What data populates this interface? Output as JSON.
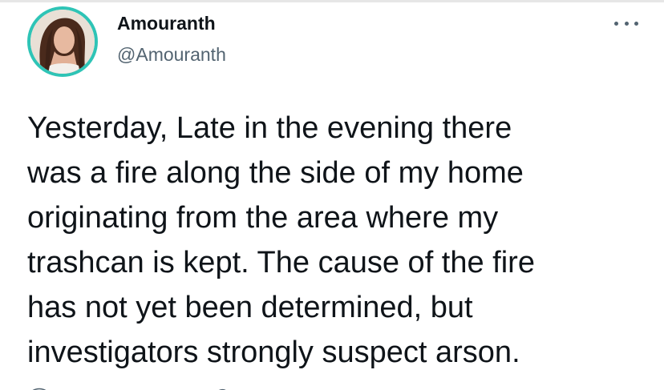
{
  "tweet": {
    "author": {
      "display_name": "Amouranth",
      "handle": "@Amouranth"
    },
    "more_icon": "more-horizontal-icon",
    "text": "Yesterday, Late in the evening there\nwas a fire along the side of my home\noriginating from the area where my\ntrashcan is kept.  The cause of the fire\nhas not yet been determined, but\ninvestigators strongly suspect arson."
  },
  "colors": {
    "text": "#0f1419",
    "secondary": "#536471",
    "avatar_ring": "#2ec4b6"
  }
}
